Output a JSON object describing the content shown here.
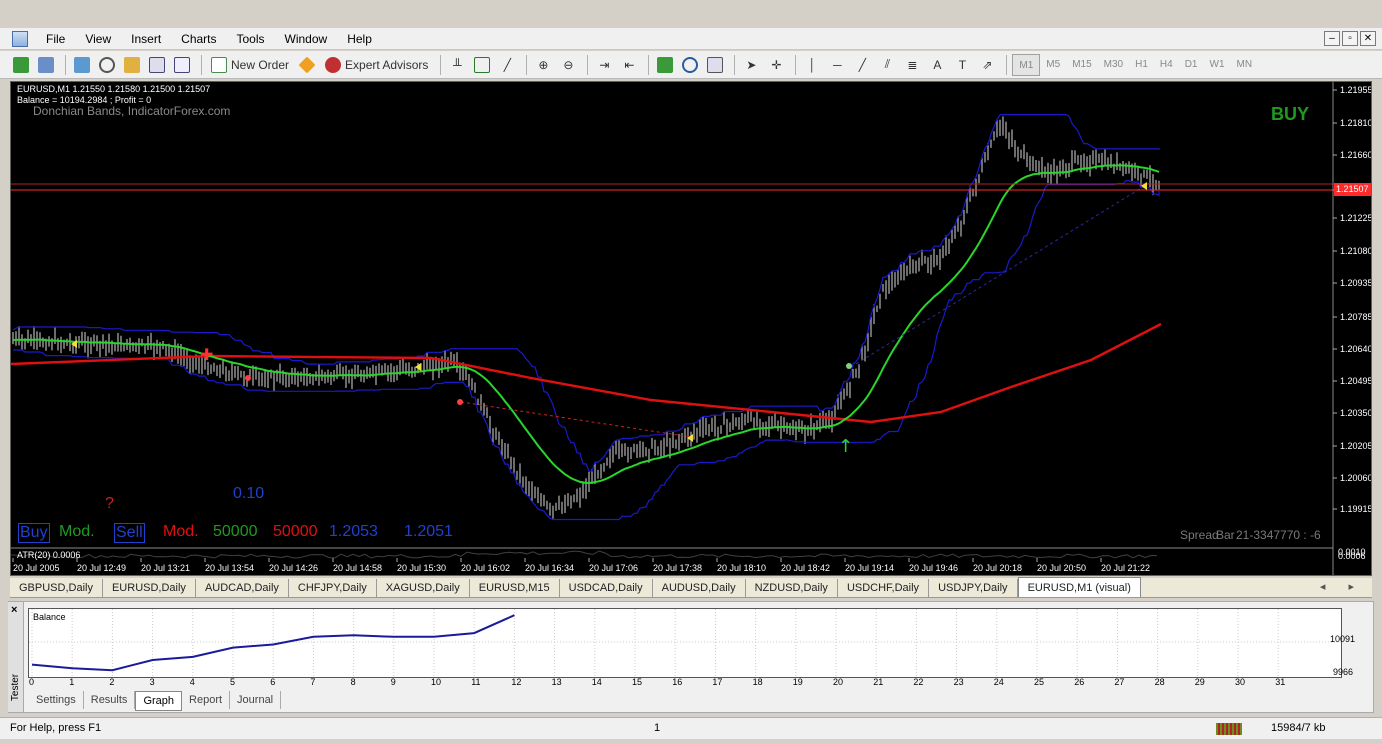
{
  "menu": [
    "File",
    "View",
    "Insert",
    "Charts",
    "Tools",
    "Window",
    "Help"
  ],
  "window_controls": [
    "–",
    "▫",
    "✕"
  ],
  "toolbar": {
    "new_order": "New Order",
    "expert_advisors": "Expert Advisors",
    "timeframes": [
      "M1",
      "M5",
      "M15",
      "M30",
      "H1",
      "H4",
      "D1",
      "W1",
      "MN"
    ],
    "active_timeframe": "M1"
  },
  "chart": {
    "header_line1": "EURUSD,M1  1.21550 1.21580 1.21500 1.21507",
    "header_line2": "Balance = 10194.2984 ; Profit = 0",
    "indicator_name": "Donchian Bands, IndicatorForex.com",
    "signal": "BUY",
    "signal_color": "#1f9a1f",
    "current_price": "1.21507",
    "price_ticks": [
      "1.21955",
      "1.21810",
      "1.21660",
      "1.21370",
      "1.21225",
      "1.21080",
      "1.20935",
      "1.20785",
      "1.20640",
      "1.20495",
      "1.20350",
      "1.20205",
      "1.20060",
      "1.19915"
    ],
    "time_ticks": [
      "20 Jul 2005",
      "20 Jul 12:49",
      "20 Jul 13:21",
      "20 Jul 13:54",
      "20 Jul 14:26",
      "20 Jul 14:58",
      "20 Jul 15:30",
      "20 Jul 16:02",
      "20 Jul 16:34",
      "20 Jul 17:06",
      "20 Jul 17:38",
      "20 Jul 18:10",
      "20 Jul 18:42",
      "20 Jul 19:14",
      "20 Jul 19:46",
      "20 Jul 20:18",
      "20 Jul 20:50",
      "20 Jul 21:22"
    ],
    "question_mark": "?",
    "lot_value": "0.10",
    "bottom_buy": "Buy",
    "bottom_mod1": "Mod.",
    "bottom_sell": "Sell",
    "bottom_mod2": "Mod.",
    "bottom_v1": "50000",
    "bottom_v2": "50000",
    "bottom_p1": "1.2053",
    "bottom_p2": "1.2051",
    "spread_text": "Spread",
    "bar_text": "Bar",
    "bar_id": "21-3347770 : -6",
    "atr_label": "ATR(20) 0.0006",
    "atr_right_1": "0.0010",
    "atr_right_2": "0.0006",
    "colors": {
      "bands": "#1a1acc",
      "ma_slow": "#e01010",
      "ma_fast": "#29d629",
      "candles": "#d8d8d8",
      "price_line": "#ff2a2a"
    }
  },
  "symbol_tabs": [
    "GBPUSD,Daily",
    "EURUSD,Daily",
    "AUDCAD,Daily",
    "CHFJPY,Daily",
    "XAGUSD,Daily",
    "EURUSD,M15",
    "USDCAD,Daily",
    "AUDUSD,Daily",
    "NZDUSD,Daily",
    "USDCHF,Daily",
    "USDJPY,Daily",
    "EURUSD,M1 (visual)"
  ],
  "symbol_nav": "◂ ▸",
  "tester": {
    "close": "×",
    "title": "Tester",
    "graph_label": "Balance",
    "y_labels": [
      "10091",
      "9966"
    ],
    "x_labels": [
      "0",
      "1",
      "2",
      "3",
      "4",
      "5",
      "6",
      "7",
      "8",
      "9",
      "10",
      "11",
      "12",
      "13",
      "14",
      "15",
      "16",
      "17",
      "18",
      "19",
      "20",
      "21",
      "22",
      "23",
      "24",
      "25",
      "26",
      "27",
      "28",
      "29",
      "30",
      "31"
    ],
    "balance_points": [
      9990,
      9978,
      9972,
      10005,
      10015,
      10045,
      10055,
      10080,
      10085,
      10080,
      10080,
      10092,
      10150
    ],
    "tabs": [
      "Settings",
      "Results",
      "Graph",
      "Report",
      "Journal"
    ],
    "active_tab": "Graph"
  },
  "status": {
    "help": "For Help, press F1",
    "page": "1",
    "traffic": "15984/7 kb"
  }
}
